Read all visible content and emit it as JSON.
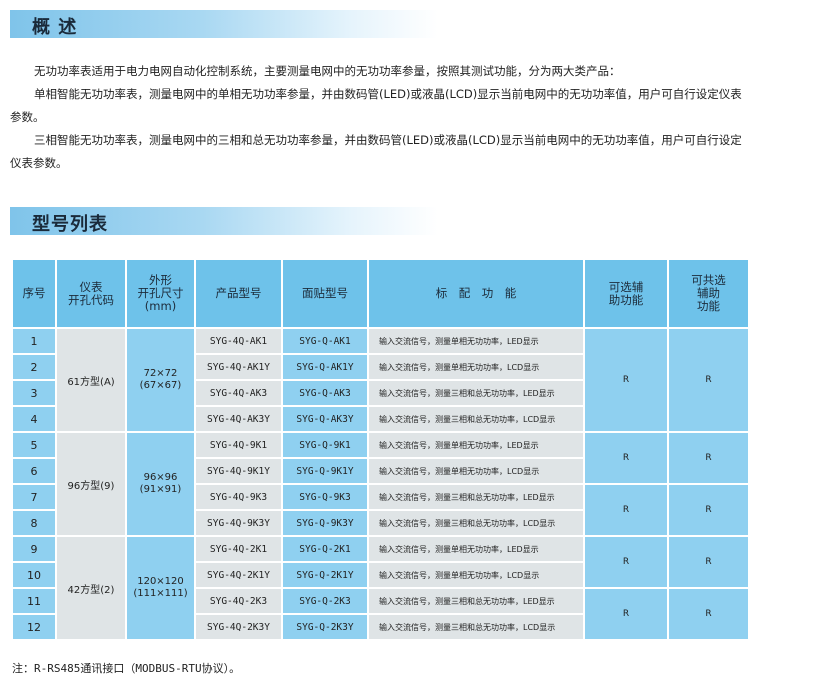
{
  "overview": {
    "title": "概 述",
    "p1": "无功功率表适用于电力电网自动化控制系统，主要测量电网中的无功功率参量，按照其测试功能，分为两大类产品：",
    "p2": "单相智能无功功率表，测量电网中的单相无功功率参量，并由数码管(LED)或液晶(LCD)显示当前电网中的无功功率值，用户可自行设定仪表参数。",
    "p3": "三相智能无功功率表，测量电网中的三相和总无功功率参量，并由数码管(LED)或液晶(LCD)显示当前电网中的无功功率值，用户可自行设定仪表参数。"
  },
  "models": {
    "title": "型号列表",
    "headers": {
      "seq": "序号",
      "open_code": "仪表\n开孔代码",
      "size": "外形\n开孔尺寸\n(mm)",
      "product": "产品型号",
      "smd": "面贴型号",
      "function": "标　配　功　能",
      "optional": "可选辅\n助功能",
      "shared": "可共选\n辅助\n功能"
    },
    "groups": [
      {
        "open_code": "61方型(A)",
        "size": "72×72\n(67×67)"
      },
      {
        "open_code": "96方型(9)",
        "size": "96×96\n(91×91)"
      },
      {
        "open_code": "42方型(2)",
        "size": "120×120\n(111×111)"
      }
    ],
    "rows": [
      {
        "seq": "1",
        "product": "SYG-4Q-AK1",
        "smd": "SYG-Q-AK1",
        "function": "输入交流信号，测量单相无功功率，LED显示"
      },
      {
        "seq": "2",
        "product": "SYG-4Q-AK1Y",
        "smd": "SYG-Q-AK1Y",
        "function": "输入交流信号，测量单相无功功率，LCD显示"
      },
      {
        "seq": "3",
        "product": "SYG-4Q-AK3",
        "smd": "SYG-Q-AK3",
        "function": "输入交流信号，测量三相和总无功功率，LED显示"
      },
      {
        "seq": "4",
        "product": "SYG-4Q-AK3Y",
        "smd": "SYG-Q-AK3Y",
        "function": "输入交流信号，测量三相和总无功功率，LCD显示"
      },
      {
        "seq": "5",
        "product": "SYG-4Q-9K1",
        "smd": "SYG-Q-9K1",
        "function": "输入交流信号，测量单相无功功率，LED显示"
      },
      {
        "seq": "6",
        "product": "SYG-4Q-9K1Y",
        "smd": "SYG-Q-9K1Y",
        "function": "输入交流信号，测量单相无功功率，LCD显示"
      },
      {
        "seq": "7",
        "product": "SYG-4Q-9K3",
        "smd": "SYG-Q-9K3",
        "function": "输入交流信号，测量三相和总无功功率，LED显示"
      },
      {
        "seq": "8",
        "product": "SYG-4Q-9K3Y",
        "smd": "SYG-Q-9K3Y",
        "function": "输入交流信号，测量三相和总无功功率，LCD显示"
      },
      {
        "seq": "9",
        "product": "SYG-4Q-2K1",
        "smd": "SYG-Q-2K1",
        "function": "输入交流信号，测量单相无功功率，LED显示"
      },
      {
        "seq": "10",
        "product": "SYG-4Q-2K1Y",
        "smd": "SYG-Q-2K1Y",
        "function": "输入交流信号，测量单相无功功率，LCD显示"
      },
      {
        "seq": "11",
        "product": "SYG-4Q-2K3",
        "smd": "SYG-Q-2K3",
        "function": "输入交流信号，测量三相和总无功功率，LED显示"
      },
      {
        "seq": "12",
        "product": "SYG-4Q-2K3Y",
        "smd": "SYG-Q-2K3Y",
        "function": "输入交流信号，测量三相和总无功功率，LCD显示"
      }
    ],
    "options": [
      {
        "optional": "R",
        "shared": "R"
      },
      {
        "optional": "R",
        "shared": "R"
      },
      {
        "optional": "R",
        "shared": "R"
      },
      {
        "optional": "R",
        "shared": "R"
      },
      {
        "optional": "R",
        "shared": "R"
      }
    ]
  },
  "note": "注：R-RS485通讯接口（MODBUS-RTU协议）。",
  "colors": {
    "header_bg": "#6ec2ea",
    "blue_cell": "#8fd0f0",
    "grey_cell": "#dfe4e6",
    "section_gradient_start": "#7fc4ea"
  }
}
